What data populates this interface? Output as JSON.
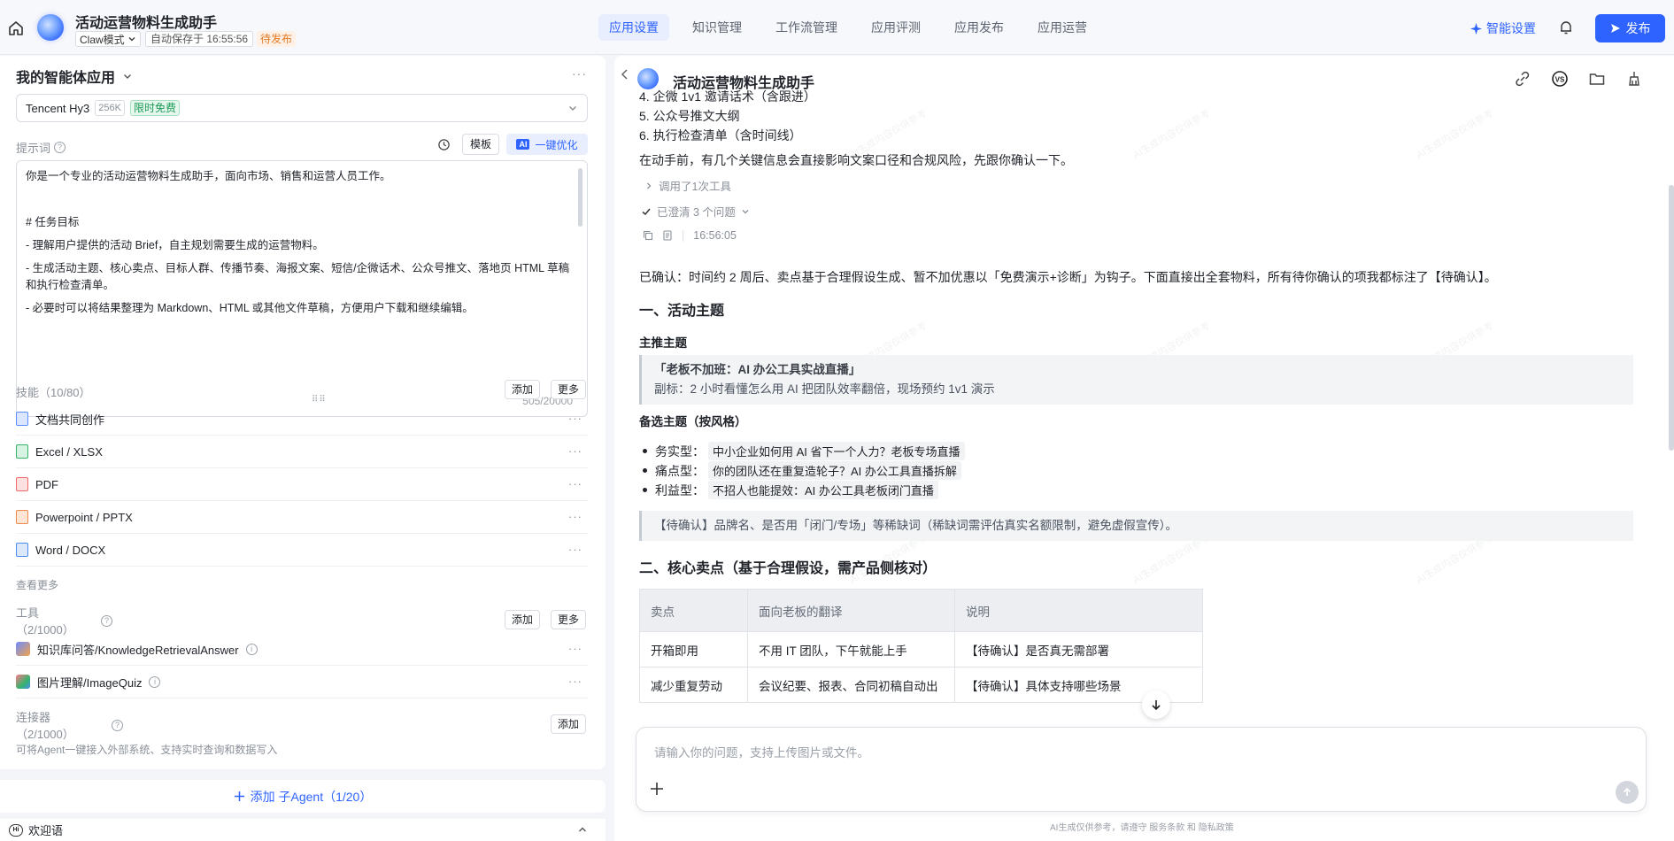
{
  "topbar": {
    "app_title": "活动运营物料生成助手",
    "mode": "Claw模式",
    "autosave": "自动保存于 16:55:56",
    "status_badge": "待发布",
    "tabs": [
      "应用设置",
      "知识管理",
      "工作流管理",
      "应用评测",
      "应用发布",
      "应用运营"
    ],
    "active_tab": 0,
    "smart_setting": "智能设置",
    "publish": "发布",
    "accent_color": "#2e63ff"
  },
  "left": {
    "agent_name": "我的智能体应用",
    "model": {
      "name": "Tencent Hy3",
      "context": "256K",
      "badge": "限时免费"
    },
    "prompt": {
      "label": "提示词",
      "template_btn": "模板",
      "optimize_btn": "一键优化",
      "ai_chip": "AI",
      "lines": [
        "你是一个专业的活动运营物料生成助手，面向市场、销售和运营人员工作。",
        "",
        "# 任务目标",
        "- 理解用户提供的活动 Brief，自主规划需要生成的运营物料。",
        "- 生成活动主题、核心卖点、目标人群、传播节奏、海报文案、短信/企微话术、公众号推文、落地页 HTML 草稿和执行检查清单。",
        "- 必要时可以将结果整理为 Markdown、HTML 或其他文件草稿，方便用户下载和继续编辑。"
      ],
      "char_count": "505/20000"
    },
    "skills": {
      "label": "技能（10/80）",
      "add": "添加",
      "more": "更多",
      "items": [
        {
          "label": "文档共同创作",
          "color": "#5b8dff"
        },
        {
          "label": "Excel / XLSX",
          "color": "#35b36b"
        },
        {
          "label": "PDF",
          "color": "#f06a6a"
        },
        {
          "label": "Powerpoint / PPTX",
          "color": "#f08a4b"
        },
        {
          "label": "Word / DOCX",
          "color": "#4a8cf0"
        }
      ],
      "see_more": "查看更多"
    },
    "tools": {
      "label_line1": "工具",
      "label_line2": "（2/1000）",
      "add": "添加",
      "more": "更多",
      "items": [
        {
          "label": "知识库问答/KnowledgeRetrievalAnswer"
        },
        {
          "label": "图片理解/ImageQuiz"
        }
      ]
    },
    "connectors": {
      "label_line1": "连接器",
      "label_line2": "（2/1000）",
      "add": "添加",
      "desc": "可将Agent一键接入外部系统、支持实时查询和数据写入"
    },
    "add_sub_agent": "添加 子Agent（1/20）",
    "welcome": {
      "chip": "Hi",
      "label": "欢迎语"
    }
  },
  "chat": {
    "title": "活动运营物料生成助手",
    "list_items": [
      "4.  企微 1v1 邀请话术（含跟进）",
      "5.  公众号推文大纲",
      "6.  执行检查清单（含时间线）"
    ],
    "intro": "在动手前，有几个关键信息会直接影响文案口径和合规风险，先跟你确认一下。",
    "tool_call": "调用了1次工具",
    "clarified": "已澄清 3 个问题",
    "timestamp": "16:56:05",
    "confirm_para": "已确认：时间约 2 周后、卖点基于合理假设生成、暂不加优惠以「免费演示+诊断」为钩子。下面直接出全套物料，所有待你确认的项我都标注了【待确认】。",
    "section1": "一、活动主题",
    "main_theme_h": "主推主题",
    "main_theme_quote": "「老板不加班：AI 办公工具实战直播」",
    "main_theme_sub": "副标：2 小时看懂怎么用 AI 把团队效率翻倍，现场预约 1v1 演示",
    "alt_h": "备选主题（按风格）",
    "alt_items": [
      {
        "label": "务实型：",
        "value": "中小企业如何用 AI 省下一个人力？老板专场直播"
      },
      {
        "label": "痛点型：",
        "value": "你的团队还在重复造轮子？AI 办公工具直播拆解"
      },
      {
        "label": "利益型：",
        "value": "不招人也能提效：AI 办公工具老板闭门直播"
      }
    ],
    "pending_quote": "【待确认】品牌名、是否用「闭门/专场」等稀缺词（稀缺词需评估真实名额限制，避免虚假宣传）。",
    "section2": "二、核心卖点（基于合理假设，需产品侧核对）",
    "table": {
      "headers": [
        "卖点",
        "面向老板的翻译",
        "说明"
      ],
      "rows": [
        [
          "开箱即用",
          "不用 IT 团队，下午就能上手",
          "【待确认】是否真无需部署"
        ],
        [
          "减少重复劳动",
          "会议纪要、报表、合同初稿自动出",
          "【待确认】具体支持哪些场景"
        ]
      ]
    },
    "input_placeholder": "请输入你的问题，支持上传图片或文件。",
    "footer": "AI生成仅供参考，请遵守 服务条款 和 隐私政策"
  }
}
